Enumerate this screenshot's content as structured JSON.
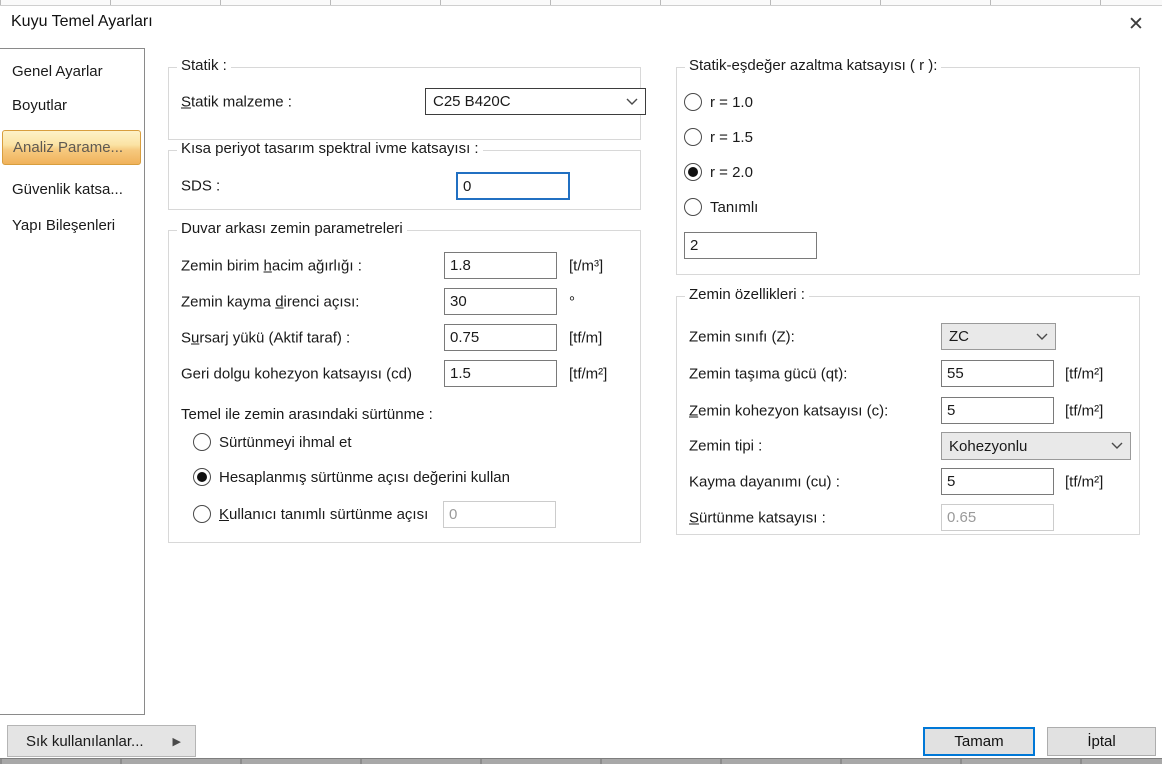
{
  "window": {
    "title": "Kuyu Temel Ayarları"
  },
  "icons": {
    "close": "✕",
    "submenu_arrow": "▶",
    "dropdown": "chevron-down"
  },
  "colors": {
    "accent_blue": "#0078d7",
    "focus_border": "#2170c2",
    "selected_item_top": "#fdf2c8",
    "selected_item_bottom": "#f0b25b",
    "selected_item_border": "#d89e3e",
    "combo_gray_bg": "#e9e9e9"
  },
  "sidebar": {
    "items": [
      {
        "label": "Genel Ayarlar",
        "selected": false
      },
      {
        "label": "Boyutlar",
        "selected": false
      },
      {
        "label": "Analiz Parame...",
        "selected": true
      },
      {
        "label": "Güvenlik katsa...",
        "selected": false
      },
      {
        "label": "Yapı Bileşenleri",
        "selected": false
      }
    ]
  },
  "statik_group": {
    "legend": "Statik :",
    "material_label": "Statik malzeme :",
    "material_value": "C25 B420C"
  },
  "sds_group": {
    "legend": "Kısa periyot tasarım spektral ivme katsayısı :",
    "label": "SDS :",
    "value": "0"
  },
  "duvar_group": {
    "legend": "Duvar arkası zemin parametreleri",
    "rows": [
      {
        "label": "Zemin birim hacim ağırlığı :",
        "value": "1.8",
        "unit": "[t/m³]"
      },
      {
        "label": "Zemin kayma direnci açısı:",
        "value": "30",
        "unit": "°"
      },
      {
        "label": "Sursarj yükü (Aktif taraf) :",
        "value": "0.75",
        "unit": "[tf/m]"
      },
      {
        "label": "Geri dolgu kohezyon katsayısı (cd)",
        "value": "1.5",
        "unit": "[tf/m²]"
      }
    ],
    "friction_label": "Temel ile zemin arasındaki sürtünme :",
    "radios": [
      {
        "label": "Sürtünmeyi ihmal et",
        "selected": false
      },
      {
        "label": "Hesaplanmış sürtünme açısı değerini kullan",
        "selected": true
      },
      {
        "label": "Kullanıcı tanımlı sürtünme açısı",
        "selected": false
      }
    ],
    "user_friction_value": "0",
    "user_friction_disabled": true
  },
  "r_group": {
    "legend": "Statik-eşdeğer azaltma katsayısı ( r ):",
    "radios": [
      {
        "label": "r = 1.0",
        "selected": false
      },
      {
        "label": "r = 1.5",
        "selected": false
      },
      {
        "label": "r = 2.0",
        "selected": true
      },
      {
        "label": "Tanımlı",
        "selected": false
      }
    ],
    "value": "2"
  },
  "zemin_group": {
    "legend": "Zemin özellikleri :",
    "rows": [
      {
        "label": "Zemin sınıfı (Z):",
        "value": "ZC",
        "type": "combo",
        "unit": ""
      },
      {
        "label": "Zemin taşıma gücü (qt):",
        "value": "55",
        "type": "input",
        "unit": "[tf/m²]"
      },
      {
        "label": "Zemin kohezyon katsayısı (c):",
        "value": "5",
        "type": "input",
        "unit": "[tf/m²]"
      },
      {
        "label": "Zemin tipi :",
        "value": "Kohezyonlu",
        "type": "combo",
        "unit": ""
      },
      {
        "label": "Kayma dayanımı (cu) :",
        "value": "5",
        "type": "input",
        "unit": "[tf/m²]"
      },
      {
        "label": "Sürtünme katsayısı :",
        "value": "0.65",
        "type": "input-disabled",
        "unit": ""
      }
    ]
  },
  "footer": {
    "favorites_label": "Sık kullanılanlar...",
    "ok_label": "Tamam",
    "cancel_label": "İptal"
  }
}
